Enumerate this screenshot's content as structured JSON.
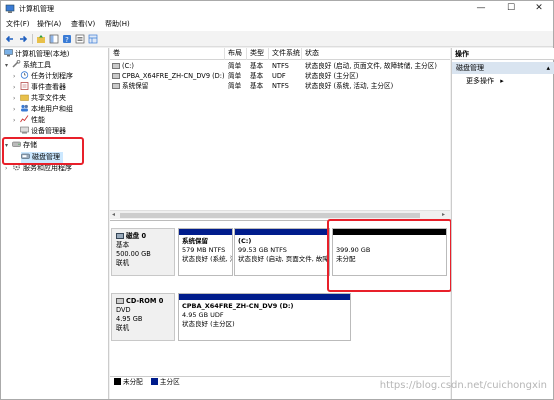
{
  "window": {
    "title": "计算机管理"
  },
  "menu": [
    "文件(F)",
    "操作(A)",
    "查看(V)",
    "帮助(H)"
  ],
  "tree": [
    {
      "label": "计算机管理(本地)",
      "name": "tree-root",
      "depth": 0,
      "exp": ""
    },
    {
      "label": "系统工具",
      "name": "tree-system-tools",
      "depth": 1,
      "exp": "▾"
    },
    {
      "label": "任务计划程序",
      "name": "tree-task-scheduler",
      "depth": 2,
      "exp": "›"
    },
    {
      "label": "事件查看器",
      "name": "tree-event-viewer",
      "depth": 2,
      "exp": "›"
    },
    {
      "label": "共享文件夹",
      "name": "tree-shared-folders",
      "depth": 2,
      "exp": "›"
    },
    {
      "label": "本地用户和组",
      "name": "tree-local-users",
      "depth": 2,
      "exp": "›"
    },
    {
      "label": "性能",
      "name": "tree-performance",
      "depth": 2,
      "exp": "›"
    },
    {
      "label": "设备管理器",
      "name": "tree-device-manager",
      "depth": 2,
      "exp": ""
    },
    {
      "label": "存储",
      "name": "tree-storage",
      "depth": 1,
      "exp": "▾"
    },
    {
      "label": "磁盘管理",
      "name": "tree-disk-management",
      "depth": 2,
      "exp": ""
    },
    {
      "label": "服务和应用程序",
      "name": "tree-services-apps",
      "depth": 1,
      "exp": "›"
    }
  ],
  "columns": [
    "卷",
    "布局",
    "类型",
    "文件系统",
    "状态"
  ],
  "volumes": [
    {
      "name": "(C:)",
      "layout": "简单",
      "type": "基本",
      "fs": "NTFS",
      "status": "状态良好 (启动, 页面文件, 故障转储, 主分区)"
    },
    {
      "name": "CPBA_X64FRE_ZH-CN_DV9 (D:)",
      "layout": "简单",
      "type": "基本",
      "fs": "UDF",
      "status": "状态良好 (主分区)"
    },
    {
      "name": "系统保留",
      "layout": "简单",
      "type": "基本",
      "fs": "NTFS",
      "status": "状态良好 (系统, 活动, 主分区)"
    }
  ],
  "disks": {
    "disk0": {
      "name": "磁盘 0",
      "type": "基本",
      "size": "500.00 GB",
      "state": "联机",
      "partitions": [
        {
          "name": "系统保留",
          "size": "579 MB NTFS",
          "status": "状态良好 (系统, 活动, 主分区)",
          "kind": "primary"
        },
        {
          "name": "(C:)",
          "size": "99.53 GB NTFS",
          "status": "状态良好 (启动, 页面文件, 故障转储, 主分区)",
          "kind": "primary"
        },
        {
          "name": "",
          "size": "399.90 GB",
          "status": "未分配",
          "kind": "unallocated"
        }
      ]
    },
    "cdrom0": {
      "name": "CD-ROM 0",
      "type": "DVD",
      "size": "4.95 GB",
      "state": "联机",
      "partitions": [
        {
          "name": "CPBA_X64FRE_ZH-CN_DV9  (D:)",
          "size": "4.95 GB UDF",
          "status": "状态良好 (主分区)",
          "kind": "primary"
        }
      ]
    }
  },
  "legend": [
    {
      "label": "未分配",
      "color": "#000000"
    },
    {
      "label": "主分区",
      "color": "#001c8c"
    }
  ],
  "actions": {
    "header": "操作",
    "section": "磁盘管理",
    "more": "更多操作"
  },
  "watermark": "https://blog.csdn.net/cuichongxin",
  "colors": {
    "highlight": "#e8202a",
    "primary_bar": "#001c8c",
    "selection": "#cce8ff"
  }
}
